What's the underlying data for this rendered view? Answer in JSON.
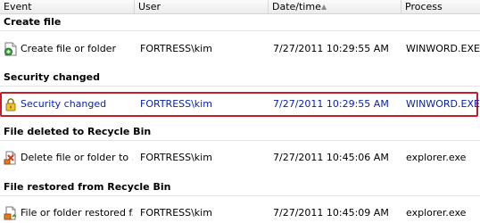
{
  "columns": {
    "event": "Event",
    "user": "User",
    "datetime": "Date/time",
    "process": "Process"
  },
  "groups": [
    {
      "title": "Create file",
      "row": {
        "event": "Create file or folder",
        "user": "FORTRESS\\kim",
        "datetime": "7/27/2011 10:29:55 AM",
        "process": "WINWORD.EXE",
        "icon": "create-file-icon"
      }
    },
    {
      "title": "Security changed",
      "row": {
        "event": "Security changed",
        "user": "FORTRESS\\kim",
        "datetime": "7/27/2011 10:29:55 AM",
        "process": "WINWORD.EXE",
        "icon": "lock-icon",
        "selected": true
      }
    },
    {
      "title": "File deleted to Recycle Bin",
      "row": {
        "event": "Delete file or folder to ...",
        "user": "FORTRESS\\kim",
        "datetime": "7/27/2011 10:45:06 AM",
        "process": "explorer.exe",
        "icon": "delete-file-icon"
      }
    },
    {
      "title": "File restored from Recycle Bin",
      "row": {
        "event": "File or folder restored f...",
        "user": "FORTRESS\\kim",
        "datetime": "7/27/2011 10:45:09 AM",
        "process": "explorer.exe",
        "icon": "restore-file-icon"
      }
    }
  ],
  "colors": {
    "selection_border": "#c01f2a",
    "selected_text": "#0b23a8"
  }
}
